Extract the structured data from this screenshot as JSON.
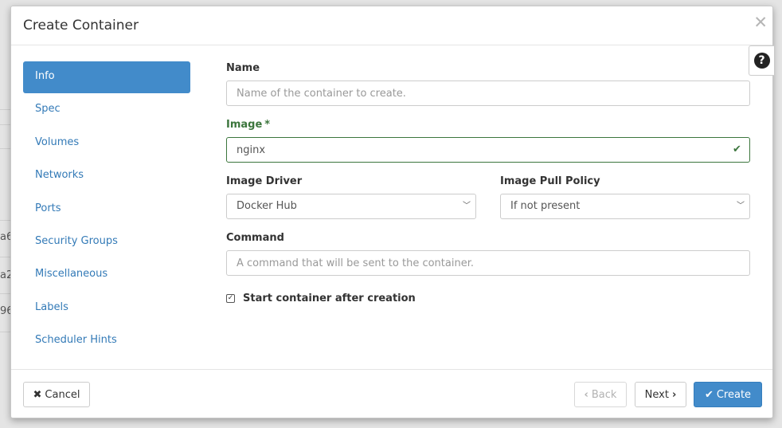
{
  "background": {
    "row_fragments": [
      "a6",
      "a2",
      "96"
    ]
  },
  "modal": {
    "title": "Create Container",
    "close_icon": "close-icon",
    "help_icon": "question-circle-icon"
  },
  "nav": {
    "items": [
      {
        "label": "Info",
        "active": true
      },
      {
        "label": "Spec"
      },
      {
        "label": "Volumes"
      },
      {
        "label": "Networks"
      },
      {
        "label": "Ports"
      },
      {
        "label": "Security Groups"
      },
      {
        "label": "Miscellaneous"
      },
      {
        "label": "Labels"
      },
      {
        "label": "Scheduler Hints"
      }
    ]
  },
  "form": {
    "name": {
      "label": "Name",
      "value": "",
      "placeholder": "Name of the container to create."
    },
    "image": {
      "label": "Image",
      "required_mark": "*",
      "value": "nginx",
      "valid_icon": "check-icon"
    },
    "image_driver": {
      "label": "Image Driver",
      "selected": "Docker Hub"
    },
    "image_pull_policy": {
      "label": "Image Pull Policy",
      "selected": "If not present"
    },
    "command": {
      "label": "Command",
      "value": "",
      "placeholder": "A command that will be sent to the container."
    },
    "start_after_creation": {
      "label": "Start container after creation",
      "checked": true
    }
  },
  "footer": {
    "cancel_icon": "times-icon",
    "cancel_label": "Cancel",
    "back_icon": "chevron-left-icon",
    "back_label": "Back",
    "next_label": "Next",
    "next_icon": "chevron-right-icon",
    "create_icon": "check-icon",
    "create_label": "Create"
  },
  "colors": {
    "primary": "#428bca",
    "success": "#3c763d",
    "link": "#337ab7"
  }
}
